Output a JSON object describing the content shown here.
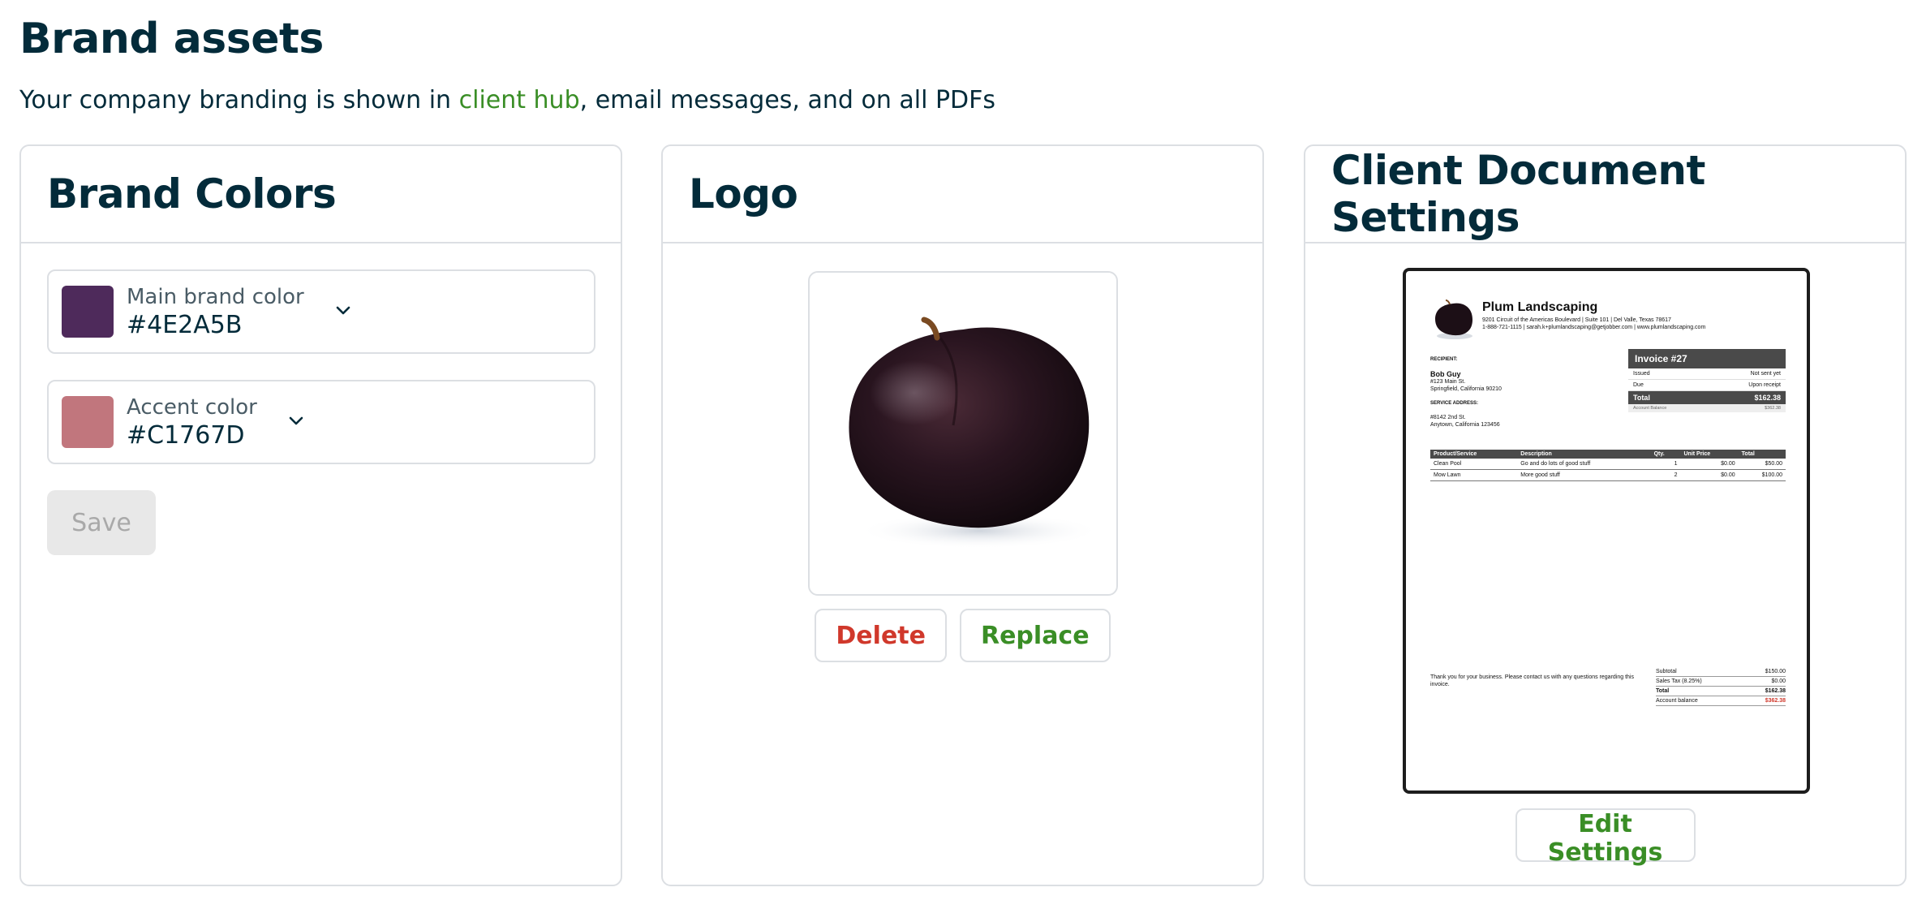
{
  "header": {
    "title": "Brand assets",
    "subtitle_before": "Your company branding is shown in ",
    "subtitle_link": "client hub",
    "subtitle_after": ", email messages, and on all PDFs"
  },
  "brand_colors": {
    "title": "Brand Colors",
    "main": {
      "label": "Main brand color",
      "value": "#4E2A5B",
      "color": "#4E2A5B"
    },
    "accent": {
      "label": "Accent color",
      "value": "#C1767D",
      "color": "#C1767D"
    },
    "save_label": "Save"
  },
  "logo": {
    "title": "Logo",
    "delete_label": "Delete",
    "replace_label": "Replace"
  },
  "document_settings": {
    "title": "Client Document Settings",
    "edit_label": "Edit Settings",
    "preview": {
      "company": "Plum Landscaping",
      "address_line1": "9201 Circuit of the Americas Boulevard  |  Suite 101  |  Del Valle, Texas 78617",
      "address_line2": "1-888-721-1115  |  sarah.k+plumlandscaping@getjobber.com  |  www.plumlandscaping.com",
      "recipient_label": "RECIPIENT:",
      "recipient_name": "Bob Guy",
      "recipient_addr1": "#123 Main St.",
      "recipient_addr2": "Springfield, California 90210",
      "service_label": "SERVICE ADDRESS:",
      "service_addr1": "#8142 2nd St.",
      "service_addr2": "Anytown, California 123456",
      "invoice_title": "Invoice #27",
      "issued_label": "Issued",
      "issued_value": "Not sent yet",
      "due_label": "Due",
      "due_value": "Upon receipt",
      "total_label": "Total",
      "total_value": "$162.38",
      "balance_label": "Account Balance",
      "balance_value": "$362.38",
      "columns": [
        "Product/Service",
        "Description",
        "Qty.",
        "Unit Price",
        "Total"
      ],
      "rows": [
        [
          "Clean Pool",
          "Go and do lots of good stuff",
          "1",
          "$0.00",
          "$50.00"
        ],
        [
          "Mow Lawn",
          "More good stuff",
          "2",
          "$0.00",
          "$100.00"
        ]
      ],
      "thanks": "Thank you for your business. Please contact us with any questions regarding this invoice.",
      "subtotal_label": "Subtotal",
      "subtotal_value": "$150.00",
      "tax_label": "Sales Tax (8.25%)",
      "tax_value": "$0.00",
      "sum_total_label": "Total",
      "sum_total_value": "$162.38",
      "acct_balance_label": "Account balance",
      "acct_balance_value": "$362.38"
    }
  },
  "colors": {
    "heading": "#032B3A",
    "link_green": "#3A8E26",
    "danger_red": "#D0382B",
    "border": "#DCDFE3"
  }
}
